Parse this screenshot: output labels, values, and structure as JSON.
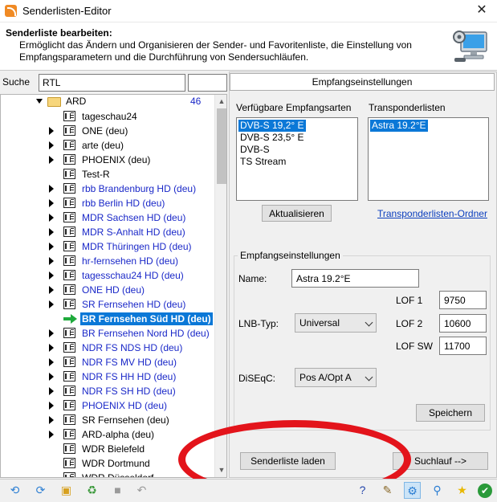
{
  "window": {
    "title": "Senderlisten-Editor",
    "close_glyph": "✕"
  },
  "header": {
    "title": "Senderliste bearbeiten:",
    "description": "Ermöglicht das Ändern und Organisieren der Sender- und Favoritenliste, die Einstellung von Empfangsparametern und die Durchführung von Sendersuchläufen."
  },
  "search": {
    "label": "Suche",
    "value": "RTL"
  },
  "tree": {
    "folder": {
      "label": "ARD",
      "count": "46"
    },
    "channels": [
      {
        "label": "tageschau24",
        "hd": false,
        "expandable": false,
        "selected": false
      },
      {
        "label": "ONE (deu)",
        "hd": false,
        "expandable": true,
        "selected": false
      },
      {
        "label": "arte (deu)",
        "hd": false,
        "expandable": true,
        "selected": false
      },
      {
        "label": "PHOENIX (deu)",
        "hd": false,
        "expandable": true,
        "selected": false
      },
      {
        "label": "Test-R",
        "hd": false,
        "expandable": false,
        "selected": false
      },
      {
        "label": "rbb Brandenburg HD (deu)",
        "hd": true,
        "expandable": true,
        "selected": false
      },
      {
        "label": "rbb Berlin HD (deu)",
        "hd": true,
        "expandable": true,
        "selected": false
      },
      {
        "label": "MDR Sachsen HD (deu)",
        "hd": true,
        "expandable": true,
        "selected": false
      },
      {
        "label": "MDR S-Anhalt HD (deu)",
        "hd": true,
        "expandable": true,
        "selected": false
      },
      {
        "label": "MDR Thüringen HD (deu)",
        "hd": true,
        "expandable": true,
        "selected": false
      },
      {
        "label": "hr-fernsehen HD (deu)",
        "hd": true,
        "expandable": true,
        "selected": false
      },
      {
        "label": "tagesschau24 HD (deu)",
        "hd": true,
        "expandable": true,
        "selected": false
      },
      {
        "label": "ONE HD (deu)",
        "hd": true,
        "expandable": true,
        "selected": false
      },
      {
        "label": "SR Fernsehen HD (deu)",
        "hd": true,
        "expandable": true,
        "selected": false
      },
      {
        "label": "BR Fernsehen Süd HD (deu)",
        "hd": true,
        "expandable": false,
        "selected": true
      },
      {
        "label": "BR Fernsehen Nord HD (deu)",
        "hd": true,
        "expandable": true,
        "selected": false
      },
      {
        "label": "NDR FS NDS HD (deu)",
        "hd": true,
        "expandable": true,
        "selected": false
      },
      {
        "label": "NDR FS MV HD (deu)",
        "hd": true,
        "expandable": true,
        "selected": false
      },
      {
        "label": "NDR FS HH HD (deu)",
        "hd": true,
        "expandable": true,
        "selected": false
      },
      {
        "label": "NDR FS SH HD (deu)",
        "hd": true,
        "expandable": true,
        "selected": false
      },
      {
        "label": "PHOENIX HD (deu)",
        "hd": true,
        "expandable": true,
        "selected": false
      },
      {
        "label": "SR Fernsehen (deu)",
        "hd": false,
        "expandable": true,
        "selected": false
      },
      {
        "label": "ARD-alpha (deu)",
        "hd": false,
        "expandable": true,
        "selected": false
      },
      {
        "label": "WDR Bielefeld",
        "hd": false,
        "expandable": false,
        "selected": false
      },
      {
        "label": "WDR Dortmund",
        "hd": false,
        "expandable": false,
        "selected": false
      },
      {
        "label": "WDR Düsseldorf",
        "hd": false,
        "expandable": false,
        "selected": false
      }
    ]
  },
  "panel": {
    "tab_label": "Empfangseinstellungen",
    "reception_types_label": "Verfügbare Empfangsarten",
    "reception_types": [
      "DVB-S 19,2° E",
      "DVB-S 23,5° E",
      "DVB-S",
      "TS Stream"
    ],
    "reception_selected_index": 0,
    "transponder_label": "Transponderlisten",
    "transponder_lists": [
      "Astra 19.2°E"
    ],
    "transponder_selected_index": 0,
    "refresh_button": "Aktualisieren",
    "transponder_folder_link": "Transponderlisten-Ordner",
    "group_title": "Empfangseinstellungen",
    "name_label": "Name:",
    "name_value": "Astra 19.2°E",
    "lnb_label": "LNB-Typ:",
    "lnb_value": "Universal",
    "lof1_label": "LOF 1",
    "lof1_value": "9750",
    "lof2_label": "LOF 2",
    "lof2_value": "10600",
    "lofsw_label": "LOF SW",
    "lofsw_value": "11700",
    "diseqc_label": "DiSEqC:",
    "diseqc_value": "Pos A/Opt A",
    "save_button": "Speichern",
    "load_button": "Senderliste laden",
    "scan_button": "Suchlauf -->"
  },
  "toolbar": {
    "icons_left": [
      "refresh-icon",
      "refresh-back-icon",
      "folder-add-icon",
      "recycle-icon",
      "stop-icon",
      "undo-icon"
    ],
    "icons_right": [
      "help-icon",
      "edit-icon",
      "settings-icon",
      "search-icon",
      "favorite-star-icon",
      "ok-check-icon"
    ]
  },
  "colors": {
    "selection": "#0b78d7",
    "hd_channel_text": "#1a28c8",
    "annotation_ellipse": "#e3141b"
  }
}
